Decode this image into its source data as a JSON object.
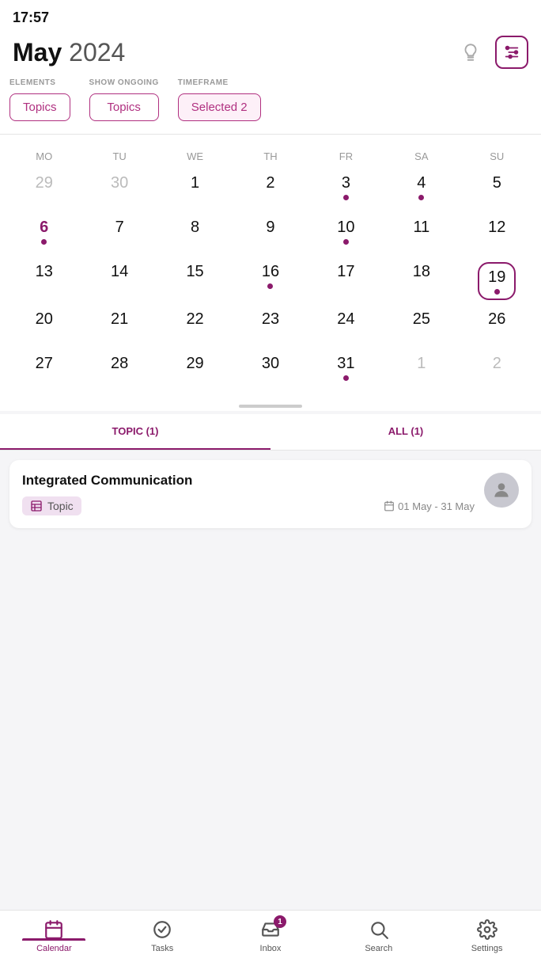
{
  "statusBar": {
    "time": "17:57"
  },
  "header": {
    "monthLabel": "May",
    "yearLabel": "2024",
    "iconHint": "💡",
    "filterButtonLabel": "filter"
  },
  "filters": {
    "elements": {
      "label": "ELEMENTS",
      "value": "Topics"
    },
    "showOngoing": {
      "label": "SHOW ONGOING",
      "value": "Topics"
    },
    "timeframe": {
      "label": "TIMEFRAME",
      "value": "Selected 2"
    }
  },
  "calendar": {
    "weekdays": [
      "MO",
      "TU",
      "WE",
      "TH",
      "FR",
      "SA",
      "SU"
    ],
    "weeks": [
      [
        {
          "day": "29",
          "grayed": true,
          "dot": false,
          "purple": false,
          "today": false
        },
        {
          "day": "30",
          "grayed": true,
          "dot": false,
          "purple": false,
          "today": false
        },
        {
          "day": "1",
          "grayed": false,
          "dot": false,
          "purple": false,
          "today": false
        },
        {
          "day": "2",
          "grayed": false,
          "dot": false,
          "purple": false,
          "today": false
        },
        {
          "day": "3",
          "grayed": false,
          "dot": true,
          "purple": false,
          "today": false
        },
        {
          "day": "4",
          "grayed": false,
          "dot": true,
          "purple": false,
          "today": false
        },
        {
          "day": "5",
          "grayed": false,
          "dot": false,
          "purple": false,
          "today": false
        }
      ],
      [
        {
          "day": "6",
          "grayed": false,
          "dot": true,
          "purple": true,
          "today": false
        },
        {
          "day": "7",
          "grayed": false,
          "dot": false,
          "purple": false,
          "today": false
        },
        {
          "day": "8",
          "grayed": false,
          "dot": false,
          "purple": false,
          "today": false
        },
        {
          "day": "9",
          "grayed": false,
          "dot": false,
          "purple": false,
          "today": false
        },
        {
          "day": "10",
          "grayed": false,
          "dot": true,
          "purple": false,
          "today": false
        },
        {
          "day": "11",
          "grayed": false,
          "dot": false,
          "purple": false,
          "today": false
        },
        {
          "day": "12",
          "grayed": false,
          "dot": false,
          "purple": false,
          "today": false
        }
      ],
      [
        {
          "day": "13",
          "grayed": false,
          "dot": false,
          "purple": false,
          "today": false
        },
        {
          "day": "14",
          "grayed": false,
          "dot": false,
          "purple": false,
          "today": false
        },
        {
          "day": "15",
          "grayed": false,
          "dot": false,
          "purple": false,
          "today": false
        },
        {
          "day": "16",
          "grayed": false,
          "dot": true,
          "purple": false,
          "today": false
        },
        {
          "day": "17",
          "grayed": false,
          "dot": false,
          "purple": false,
          "today": false
        },
        {
          "day": "18",
          "grayed": false,
          "dot": false,
          "purple": false,
          "today": false
        },
        {
          "day": "19",
          "grayed": false,
          "dot": true,
          "purple": false,
          "today": true
        }
      ],
      [
        {
          "day": "20",
          "grayed": false,
          "dot": false,
          "purple": false,
          "today": false
        },
        {
          "day": "21",
          "grayed": false,
          "dot": false,
          "purple": false,
          "today": false
        },
        {
          "day": "22",
          "grayed": false,
          "dot": false,
          "purple": false,
          "today": false
        },
        {
          "day": "23",
          "grayed": false,
          "dot": false,
          "purple": false,
          "today": false
        },
        {
          "day": "24",
          "grayed": false,
          "dot": false,
          "purple": false,
          "today": false
        },
        {
          "day": "25",
          "grayed": false,
          "dot": false,
          "purple": false,
          "today": false
        },
        {
          "day": "26",
          "grayed": false,
          "dot": false,
          "purple": false,
          "today": false
        }
      ],
      [
        {
          "day": "27",
          "grayed": false,
          "dot": false,
          "purple": false,
          "today": false
        },
        {
          "day": "28",
          "grayed": false,
          "dot": false,
          "purple": false,
          "today": false
        },
        {
          "day": "29",
          "grayed": false,
          "dot": false,
          "purple": false,
          "today": false
        },
        {
          "day": "30",
          "grayed": false,
          "dot": false,
          "purple": false,
          "today": false
        },
        {
          "day": "31",
          "grayed": false,
          "dot": true,
          "purple": false,
          "today": false
        },
        {
          "day": "1",
          "grayed": true,
          "dot": false,
          "purple": false,
          "today": false
        },
        {
          "day": "2",
          "grayed": true,
          "dot": false,
          "purple": false,
          "today": false
        }
      ]
    ]
  },
  "tabs": [
    {
      "label": "TOPIC (1)",
      "active": true
    },
    {
      "label": "ALL (1)",
      "active": false
    }
  ],
  "events": [
    {
      "title": "Integrated Communication",
      "type": "Topic",
      "dateRange": "01 May - 31 May",
      "hasAvatar": true
    }
  ],
  "bottomNav": [
    {
      "name": "calendar",
      "label": "Calendar",
      "active": true,
      "badge": null
    },
    {
      "name": "tasks",
      "label": "Tasks",
      "active": false,
      "badge": null
    },
    {
      "name": "inbox",
      "label": "Inbox",
      "active": false,
      "badge": "1"
    },
    {
      "name": "search",
      "label": "Search",
      "active": false,
      "badge": null
    },
    {
      "name": "settings",
      "label": "Settings",
      "active": false,
      "badge": null
    }
  ]
}
